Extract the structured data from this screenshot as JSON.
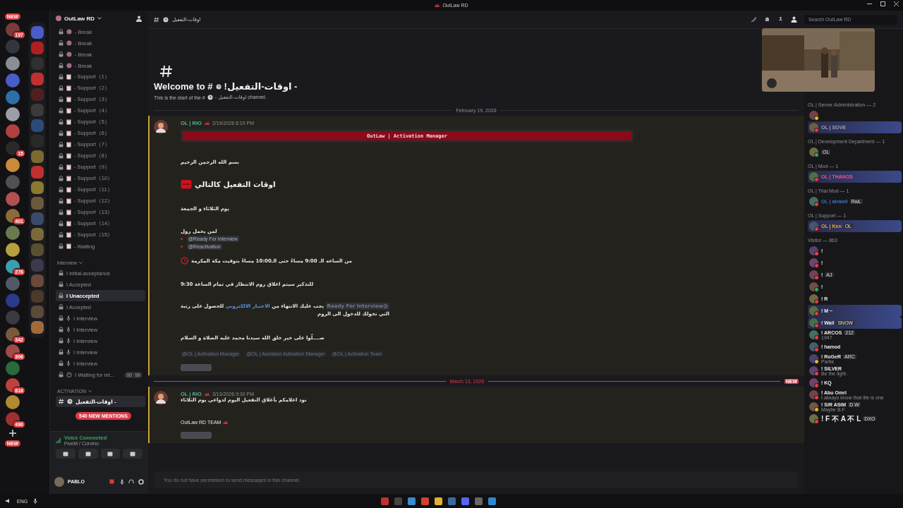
{
  "window": {
    "title": "OutLaw RD"
  },
  "server_rail": {
    "top_badge": "NEW",
    "bottom_badge": "NEW",
    "servers": [
      {
        "color": "#7a3b3b",
        "badge": "197"
      },
      {
        "color": "#33373d"
      },
      {
        "color": "#8a8f96"
      },
      {
        "color": "#4a5cc7"
      },
      {
        "color": "#2f6fa8"
      },
      {
        "color": "#9a9ea6"
      },
      {
        "color": "#b04040"
      },
      {
        "color": "#2a2a2a",
        "badge": "15"
      },
      {
        "color": "#c98a3a"
      },
      {
        "color": "#4f4f55"
      },
      {
        "color": "#b35050"
      },
      {
        "color": "#8a6b3a",
        "badge": "401"
      },
      {
        "color": "#6a7a50"
      },
      {
        "color": "#b8a040"
      },
      {
        "color": "#3aa0b0",
        "badge": "276"
      },
      {
        "color": "#505a66"
      },
      {
        "color": "#2b3a8a"
      },
      {
        "color": "#3a3a40"
      },
      {
        "color": "#7a5a3a",
        "badge": "342"
      },
      {
        "color": "#a04a4a",
        "badge": "306"
      },
      {
        "color": "#2a6a3a"
      },
      {
        "color": "#c04040",
        "badge": "816"
      },
      {
        "color": "#b08a30"
      },
      {
        "color": "#a03030",
        "badge": "490"
      }
    ],
    "folder": [
      {
        "color": "#4a5cc7"
      },
      {
        "color": "#b02020"
      },
      {
        "color": "#303030"
      },
      {
        "color": "#c03030"
      },
      {
        "color": "#502020"
      },
      {
        "color": "#3a3a3a"
      },
      {
        "color": "#2a4a7a"
      },
      {
        "color": "#2a2a2a"
      },
      {
        "color": "#7a6a30"
      },
      {
        "color": "#c03030"
      },
      {
        "color": "#8a7a30"
      },
      {
        "color": "#6a5a3a"
      },
      {
        "color": "#3a4a6a"
      },
      {
        "color": "#7a6a3a"
      },
      {
        "color": "#5a5030"
      },
      {
        "color": "#3a3a4a"
      },
      {
        "color": "#6a4a3a"
      },
      {
        "color": "#4a3a2a"
      },
      {
        "color": "#5a4a3a"
      },
      {
        "color": "#a06a3a"
      }
    ]
  },
  "channel_sidebar": {
    "server_name": "OutLaw RD",
    "channels": [
      {
        "kind": "break",
        "name": "- Break",
        "selected": false
      },
      {
        "kind": "break",
        "name": "- Break",
        "selected": false
      },
      {
        "kind": "break",
        "name": "- Break",
        "selected": false
      },
      {
        "kind": "break",
        "name": "- Break",
        "selected": false
      },
      {
        "kind": "support",
        "name": "- Support（1）",
        "selected": false
      },
      {
        "kind": "support",
        "name": "- Support（2）",
        "selected": false
      },
      {
        "kind": "support",
        "name": "- Support（3）",
        "selected": false
      },
      {
        "kind": "support",
        "name": "- Support（4）",
        "selected": false
      },
      {
        "kind": "support",
        "name": "- Support（5）",
        "selected": false
      },
      {
        "kind": "support",
        "name": "- Support（6）",
        "selected": false
      },
      {
        "kind": "support",
        "name": "- Support（7）",
        "selected": false
      },
      {
        "kind": "support",
        "name": "- Support（8）",
        "selected": false
      },
      {
        "kind": "support",
        "name": "- Support（9）",
        "selected": false
      },
      {
        "kind": "support",
        "name": "- Support（10）",
        "selected": false
      },
      {
        "kind": "support",
        "name": "- Support（11）",
        "selected": false
      },
      {
        "kind": "support",
        "name": "- Support（12）",
        "selected": false
      },
      {
        "kind": "support",
        "name": "- Support（13）",
        "selected": false
      },
      {
        "kind": "support",
        "name": "- Support（14）",
        "selected": false
      },
      {
        "kind": "support",
        "name": "- Support（15）",
        "selected": false
      },
      {
        "kind": "support",
        "name": "- Waiting",
        "selected": false
      }
    ],
    "categories": [
      {
        "name": "Interview",
        "channels": [
          {
            "kind": "plain",
            "name": "I initial-acceptance",
            "selected": false
          },
          {
            "kind": "plain",
            "name": "I Accepted",
            "selected": false
          },
          {
            "kind": "plain",
            "name": "I Unaccepted",
            "selected": true
          },
          {
            "kind": "plain",
            "name": "I Accepted",
            "selected": false
          },
          {
            "kind": "voice",
            "name": "I Interview",
            "selected": false
          },
          {
            "kind": "voice",
            "name": "I Interview",
            "selected": false
          },
          {
            "kind": "voice",
            "name": "I Interview",
            "selected": false
          },
          {
            "kind": "voice",
            "name": "I Interview",
            "selected": false
          },
          {
            "kind": "voice",
            "name": "I Interview",
            "selected": false
          },
          {
            "kind": "timer",
            "name": "I Waiting for int...",
            "selected": false,
            "users": "00",
            "limit": "99"
          }
        ]
      },
      {
        "name": "ACTIVATION",
        "channels": [
          {
            "kind": "text",
            "name": "- اوقات-التفعيل",
            "selected": true
          }
        ]
      }
    ],
    "mentions_pill": "540 NEW MENTIONS",
    "voice": {
      "status": "Voice Connected",
      "location": "FiveM / Corvino"
    },
    "user": {
      "name": "PABLO"
    }
  },
  "header": {
    "channel": "اوقات-التفعيل",
    "search_placeholder": "Search OutLaw RD"
  },
  "welcome": {
    "title_before": "Welcome to #",
    "title_after": "- اوقات-التفعيل!",
    "subtitle_before": "This is the start of the #",
    "subtitle_after": "- اوقات-التفعيل channel."
  },
  "messages": [
    {
      "divider": "February 19, 2026",
      "new": false,
      "author": "OL | RIO",
      "color": "#4fb3a0",
      "time": "2/19/2026 8:19 PM",
      "reaction": true,
      "blocks": [
        {
          "kind": "banner",
          "text": "OutLaw | Activation Manager"
        },
        {
          "kind": "text",
          "text": "بسم الله الرحمن الرحيم"
        },
        {
          "kind": "heading",
          "text": "اوقات التفعيل كالتالي"
        },
        {
          "kind": "text",
          "text": "يوم الثلاثاء و الجمعة"
        },
        {
          "kind": "text",
          "text": "لمن يحمل رول"
        },
        {
          "kind": "mention",
          "text": "@Ready For Interview"
        },
        {
          "kind": "mention",
          "text": "@Reactivation"
        },
        {
          "kind": "time",
          "text": "من الساعه الـ **9:00** مساءً حتى الـ**10:00** مساءً بتوقيت مكة المكرمة"
        },
        {
          "kind": "text",
          "text": "للتذكير سيتم اغلاق روم الانتظار في تمام الساعة 9:30"
        },
        {
          "kind": "link",
          "before": "يجب عليك الانتهاء من",
          "link": "الاختبار الالكتروني",
          "after": "للحصول على رتبة",
          "mention": "@Ready For Interview",
          "line2": "التي تخولك للدخول الى الروم"
        },
        {
          "kind": "text",
          "text": "صــــلّوا على خير خلق الله سيدنا محمد عليه الصلاة و السلام"
        },
        {
          "kind": "roles",
          "roles": [
            "@OL | Activation Manager",
            "@OL | Assistant Activation Manager",
            "@OL | Activation Team"
          ]
        }
      ]
    },
    {
      "divider": "March 13, 2026",
      "new": true,
      "new_label": "NEW",
      "author": "OL | RIO",
      "color": "#4fb3a0",
      "time": "3/13/2026 9:30 PM",
      "reaction": true,
      "blocks": [
        {
          "kind": "small",
          "text": "نود اعلامكم بأغلاق التفعيل اليوم لدواعي يوم الثلاثاء"
        },
        {
          "kind": "team",
          "text": "OutLaw RD TEAM"
        }
      ]
    }
  ],
  "input": {
    "placeholder": "You do not have permission to send messages in this channel."
  },
  "members": [
    {
      "role": "OL | Server Administration — 2",
      "members": [
        {
          "status": {
            "color": "#f0b232"
          },
          "nameplate": false
        },
        {
          "name": "OL | SOVE",
          "color": "#a0a0a8",
          "status": {
            "color": "#e0424a"
          },
          "nameplate": true
        }
      ]
    },
    {
      "role": "OL | Development Department — 1",
      "members": [
        {
          "tag": "OL",
          "status": {
            "color": "#3ba55d"
          },
          "nameplate": false
        }
      ]
    },
    {
      "role": "OL | Mod — 1",
      "members": [
        {
          "name": "OL | THANOS",
          "color": "#e2559c",
          "status": {
            "color": "#e0424a"
          },
          "nameplate": true
        }
      ]
    },
    {
      "role": "OL | Trial Mod — 1",
      "members": [
        {
          "name": "OL | atrawii",
          "color": "#3b72c0",
          "tag": "RwL",
          "status": {
            "color": "#e0424a"
          },
          "nameplate": false
        }
      ]
    },
    {
      "role": "OL | Support — 1",
      "members": [
        {
          "name": "OL | Ken",
          "color": "#f0a232",
          "tag": "OL",
          "status": {
            "color": "#e0424a"
          },
          "nameplate": true
        }
      ]
    },
    {
      "role": "Visitor — 863",
      "members": [
        {
          "name": "!",
          "status": {
            "color": "#e0424a"
          },
          "nameplate": false
        },
        {
          "name": "!",
          "status": {
            "color": "#e0424a"
          },
          "nameplate": false
        },
        {
          "name": "!",
          "tag": "AJ",
          "status": {
            "color": "#e0424a"
          },
          "nameplate": false
        },
        {
          "name": "!",
          "status": {
            "color": "#3ba55d"
          },
          "nameplate": false
        },
        {
          "name": "! R",
          "status": {
            "color": "#e0424a"
          },
          "nameplate": false
        },
        {
          "name": "! M ~",
          "status": {
            "color": "#e0424a"
          },
          "nameplate": true
        },
        {
          "name": "! Wail",
          "tag": "SNOW",
          "status": {
            "color": "#e0424a"
          },
          "nameplate": true
        },
        {
          "name": "! ARCOS",
          "tag": "212",
          "sub": "1947",
          "status": {
            "color": "#e0424a"
          },
          "nameplate": false
        },
        {
          "name": "! hamod",
          "status": {
            "color": "#e0424a"
          },
          "nameplate": false
        },
        {
          "name": "! RoGeR",
          "tag": "ARC",
          "sub": "Partie",
          "status": {
            "color": "#f0b232"
          },
          "nameplate": false
        },
        {
          "name": "! SILVER",
          "sub": "Be the light .",
          "status": {
            "color": "#e0424a"
          },
          "nameplate": false
        },
        {
          "name": "! KQ",
          "status": {
            "color": "#e0424a"
          },
          "nameplate": false
        },
        {
          "name": "! Abu Omri",
          "sub": "I always know that life is one",
          "status": {
            "color": "#e0424a"
          },
          "nameplate": false
        },
        {
          "name": "! SiR ASiM",
          "tag": "D W",
          "sub": "Maybe B.F",
          "status": {
            "color": "#f0b232"
          },
          "nameplate": false
        },
        {
          "name": "! F 不 A 不 L",
          "tag": "DXO",
          "status": {
            "color": "#e0424a"
          },
          "nameplate": false
        }
      ]
    }
  ],
  "taskbar": {
    "language": "ENG"
  }
}
